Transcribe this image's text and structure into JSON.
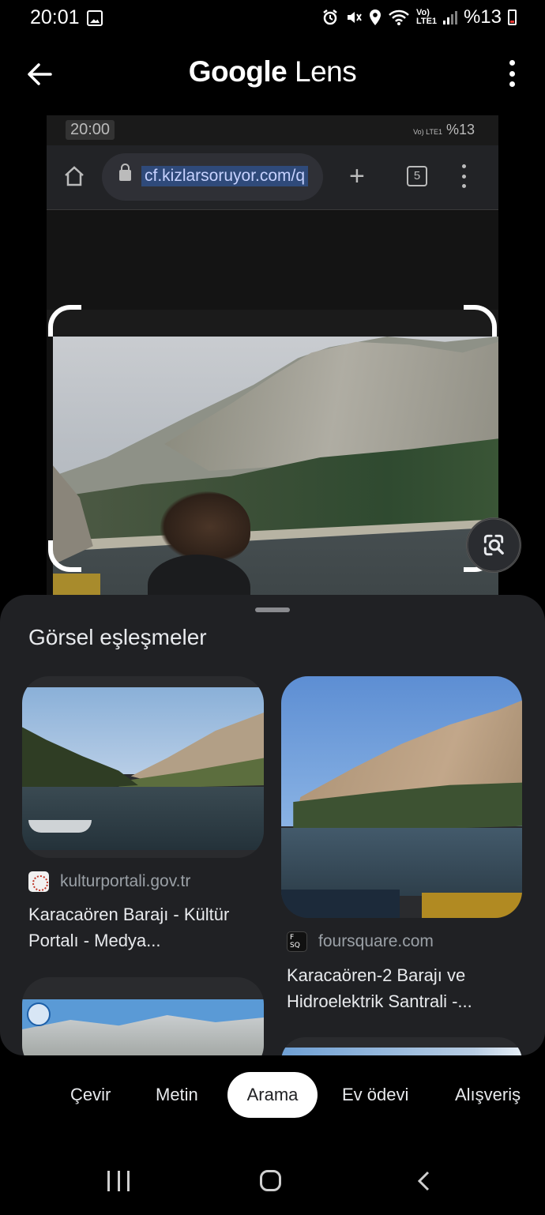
{
  "status_bar": {
    "time": "20:01",
    "battery": "%13",
    "network": "Vo) LTE1",
    "icons": [
      "gallery-icon",
      "alarm-icon",
      "mute-icon",
      "location-icon",
      "wifi-icon",
      "signal-icon",
      "battery-icon"
    ]
  },
  "app_bar": {
    "title_brand": "Google",
    "title_product": "Lens",
    "back_icon": "arrow-left-icon",
    "menu_icon": "more-vert-icon"
  },
  "captured_screen": {
    "time": "20:00",
    "battery": "%13",
    "network": "Vo) LTE1",
    "url": "cf.kizlarsoruyor.com/q",
    "tab_count": "5"
  },
  "results": {
    "title": "Görsel eşleşmeler",
    "items": [
      {
        "source": "kulturportali.gov.tr",
        "title": "Karacaören Barajı - Kültür Portalı - Medya..."
      },
      {
        "source": "foursquare.com",
        "title": "Karacaören-2 Barajı ve Hidroelektrik Santrali -..."
      }
    ]
  },
  "modes": [
    {
      "label": "Çevir",
      "active": false
    },
    {
      "label": "Metin",
      "active": false
    },
    {
      "label": "Arama",
      "active": true
    },
    {
      "label": "Ev ödevi",
      "active": false
    },
    {
      "label": "Alışveriş",
      "active": false
    }
  ],
  "colors": {
    "background": "#000000",
    "sheet": "#202124",
    "active_tab": "#ffffff",
    "secondary_text": "#9aa0a6"
  }
}
